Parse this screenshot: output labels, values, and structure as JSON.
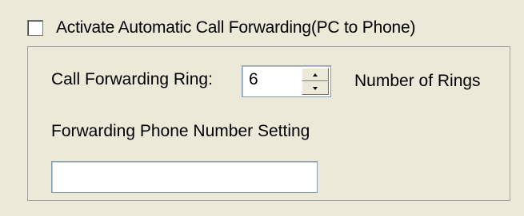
{
  "forwarding": {
    "activate_label": "Activate Automatic Call Forwarding(PC to Phone)",
    "activate_checked": false,
    "ring_label": "Call Forwarding Ring:",
    "ring_value": "6",
    "rings_unit_label": "Number of Rings",
    "phone_setting_label": "Forwarding Phone Number Setting",
    "phone_value": ""
  },
  "colors": {
    "dialog_background": "#ece9d8",
    "input_border": "#7f9db9"
  }
}
